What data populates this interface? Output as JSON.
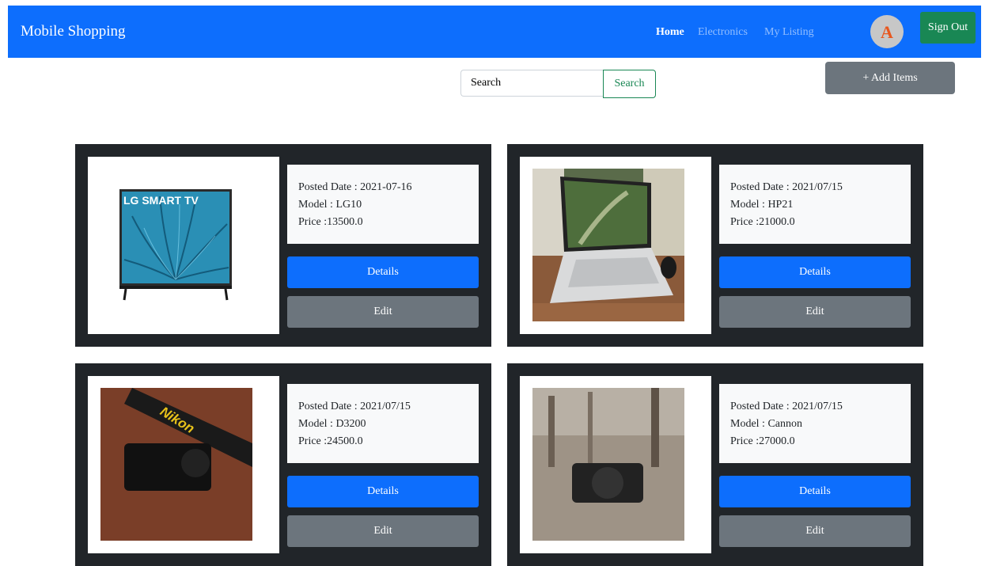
{
  "navbar": {
    "brand": "Mobile Shopping",
    "links": [
      "Home",
      "Electronics",
      "My Listing"
    ],
    "active_link": "Home",
    "avatar_letter": "A",
    "signout_label": "Sign Out"
  },
  "search": {
    "placeholder": "Search",
    "button_label": "Search"
  },
  "add_items_label": "+ Add Items",
  "listings": [
    {
      "date_text": "Posted Date : 2021-07-16",
      "model_text": "Model : LG10",
      "price_text": "Price :13500.0",
      "details_label": "Details",
      "edit_label": "Edit",
      "image_icon": "lg-smart-tv-image",
      "tv_brand_text": "LG SMART TV"
    },
    {
      "date_text": "Posted Date : 2021/07/15",
      "model_text": "Model : HP21",
      "price_text": "Price :21000.0",
      "details_label": "Details",
      "edit_label": "Edit",
      "image_icon": "laptop-image"
    },
    {
      "date_text": "Posted Date : 2021/07/15",
      "model_text": "Model : D3200",
      "price_text": "Price :24500.0",
      "details_label": "Details",
      "edit_label": "Edit",
      "image_icon": "nikon-camera-image",
      "strap_text": "Nikon"
    },
    {
      "date_text": "Posted Date : 2021/07/15",
      "model_text": "Model : Cannon",
      "price_text": "Price :27000.0",
      "details_label": "Details",
      "edit_label": "Edit",
      "image_icon": "camera-outdoor-image"
    }
  ],
  "colors": {
    "primary": "#0d6efd",
    "success": "#198754",
    "secondary": "#6c757d",
    "dark": "#212529",
    "avatar_letter": "#e8571e"
  }
}
